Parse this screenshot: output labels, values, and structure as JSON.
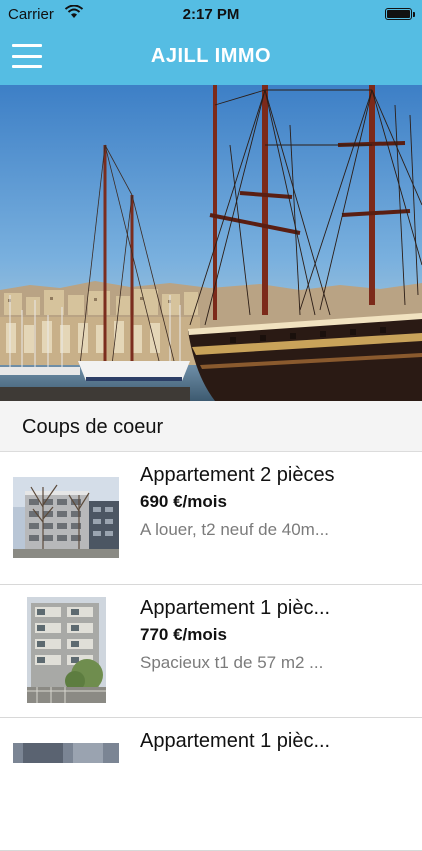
{
  "status_bar": {
    "carrier": "Carrier",
    "time": "2:17 PM",
    "icons": [
      "wifi-icon",
      "battery-icon"
    ]
  },
  "nav": {
    "title": "AJILL IMMO",
    "menu_icon": "hamburger-menu-icon"
  },
  "colors": {
    "accent": "#55bde3",
    "section_bg": "#f4f4f4",
    "desc_text": "#7b7b7b"
  },
  "section": {
    "title": "Coups de coeur"
  },
  "listings": [
    {
      "title": "Appartement 2 pièces",
      "price": "690 €/mois",
      "description": "A louer, t2 neuf de 40m..."
    },
    {
      "title": "Appartement 1 pièc...",
      "price": "770 €/mois",
      "description": "Spacieux t1 de 57 m2 ..."
    },
    {
      "title": "Appartement 1 pièc..."
    }
  ]
}
